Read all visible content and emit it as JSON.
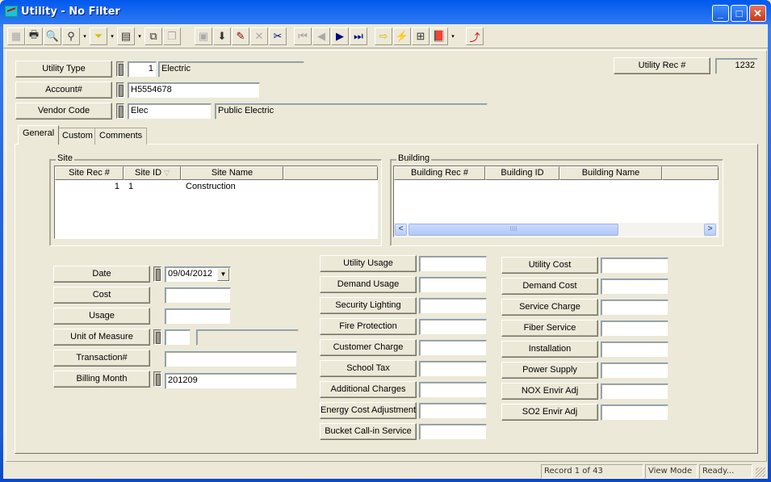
{
  "window": {
    "title": "Utility - No Filter",
    "minimize": "_",
    "maximize": "□",
    "close": "✕"
  },
  "toolbar": {
    "items": [
      {
        "name": "form-view-icon",
        "glyph": "▦"
      },
      {
        "name": "print-icon",
        "glyph": "🖶"
      },
      {
        "name": "print-preview-icon",
        "glyph": "🔍"
      },
      {
        "name": "find-icon",
        "glyph": "⚲"
      },
      {
        "name": "filter-icon",
        "glyph": "⏷"
      },
      {
        "name": "report-icon",
        "glyph": "▤"
      },
      {
        "name": "export-icon",
        "glyph": "⧉"
      },
      {
        "name": "copy-record-icon",
        "glyph": "❐"
      },
      {
        "name": "save-icon",
        "glyph": "▣"
      },
      {
        "name": "new-record-icon",
        "glyph": "⬇"
      },
      {
        "name": "edit-icon",
        "glyph": "✎"
      },
      {
        "name": "delete-icon",
        "glyph": "✕"
      },
      {
        "name": "cut-icon",
        "glyph": "✂"
      },
      {
        "name": "first-record-icon",
        "glyph": "⏮"
      },
      {
        "name": "previous-record-icon",
        "glyph": "◀"
      },
      {
        "name": "next-record-icon",
        "glyph": "▶"
      },
      {
        "name": "last-record-icon",
        "glyph": "⏭"
      },
      {
        "name": "goto-icon",
        "glyph": "⇨"
      },
      {
        "name": "quick-action-icon",
        "glyph": "⚡"
      },
      {
        "name": "hierarchy-icon",
        "glyph": "⊞"
      },
      {
        "name": "book-icon",
        "glyph": "📕"
      },
      {
        "name": "exit-icon",
        "glyph": "⤴"
      }
    ],
    "dropdown": "▾"
  },
  "header": {
    "utility_type": {
      "label": "Utility Type",
      "code": "1",
      "desc": "Electric"
    },
    "account": {
      "label": "Account#",
      "value": "H5554678"
    },
    "vendor": {
      "label": "Vendor Code",
      "code": "Elec",
      "desc": "Public Electric"
    },
    "rec": {
      "label": "Utility Rec #",
      "value": "1232"
    }
  },
  "tabs": [
    {
      "label": "General"
    },
    {
      "label": "Custom"
    },
    {
      "label": "Comments"
    }
  ],
  "site": {
    "title": "Site",
    "columns": [
      "Site Rec #",
      "Site ID",
      "Site Name",
      ""
    ],
    "sort_indicator": "▽",
    "rows": [
      {
        "rec": "1",
        "id": "1",
        "name": "Construction"
      }
    ]
  },
  "building": {
    "title": "Building",
    "columns": [
      "Building Rec #",
      "Building ID",
      "Building Name",
      ""
    ],
    "rows": [],
    "scroll_left": "<",
    "scroll_right": ">",
    "scroll_grip": "IIII"
  },
  "left_fields": {
    "date": {
      "label": "Date",
      "value": "09/04/2012"
    },
    "cost": {
      "label": "Cost",
      "value": ""
    },
    "usage": {
      "label": "Usage",
      "value": ""
    },
    "uom": {
      "label": "Unit of Measure",
      "code": "",
      "desc": ""
    },
    "transaction": {
      "label": "Transaction#",
      "value": ""
    },
    "billing_month": {
      "label": "Billing Month",
      "value": "201209"
    }
  },
  "mid_fields": [
    {
      "label": "Utility Usage",
      "value": ""
    },
    {
      "label": "Demand Usage",
      "value": ""
    },
    {
      "label": "Security Lighting",
      "value": ""
    },
    {
      "label": "Fire Protection",
      "value": ""
    },
    {
      "label": "Customer Charge",
      "value": ""
    },
    {
      "label": "School Tax",
      "value": ""
    },
    {
      "label": "Additional Charges",
      "value": ""
    },
    {
      "label": "Energy Cost Adjustment",
      "value": ""
    },
    {
      "label": "Bucket Call-in Service",
      "value": ""
    }
  ],
  "right_fields": [
    {
      "label": "Utility Cost",
      "value": ""
    },
    {
      "label": "Demand Cost",
      "value": ""
    },
    {
      "label": "Service Charge",
      "value": ""
    },
    {
      "label": "Fiber Service",
      "value": ""
    },
    {
      "label": "Installation",
      "value": ""
    },
    {
      "label": "Power Supply",
      "value": ""
    },
    {
      "label": "NOX Envir Adj",
      "value": ""
    },
    {
      "label": "SO2 Envir Adj",
      "value": ""
    }
  ],
  "status": {
    "record": "Record 1 of 43",
    "mode": "View Mode",
    "state": "Ready..."
  }
}
